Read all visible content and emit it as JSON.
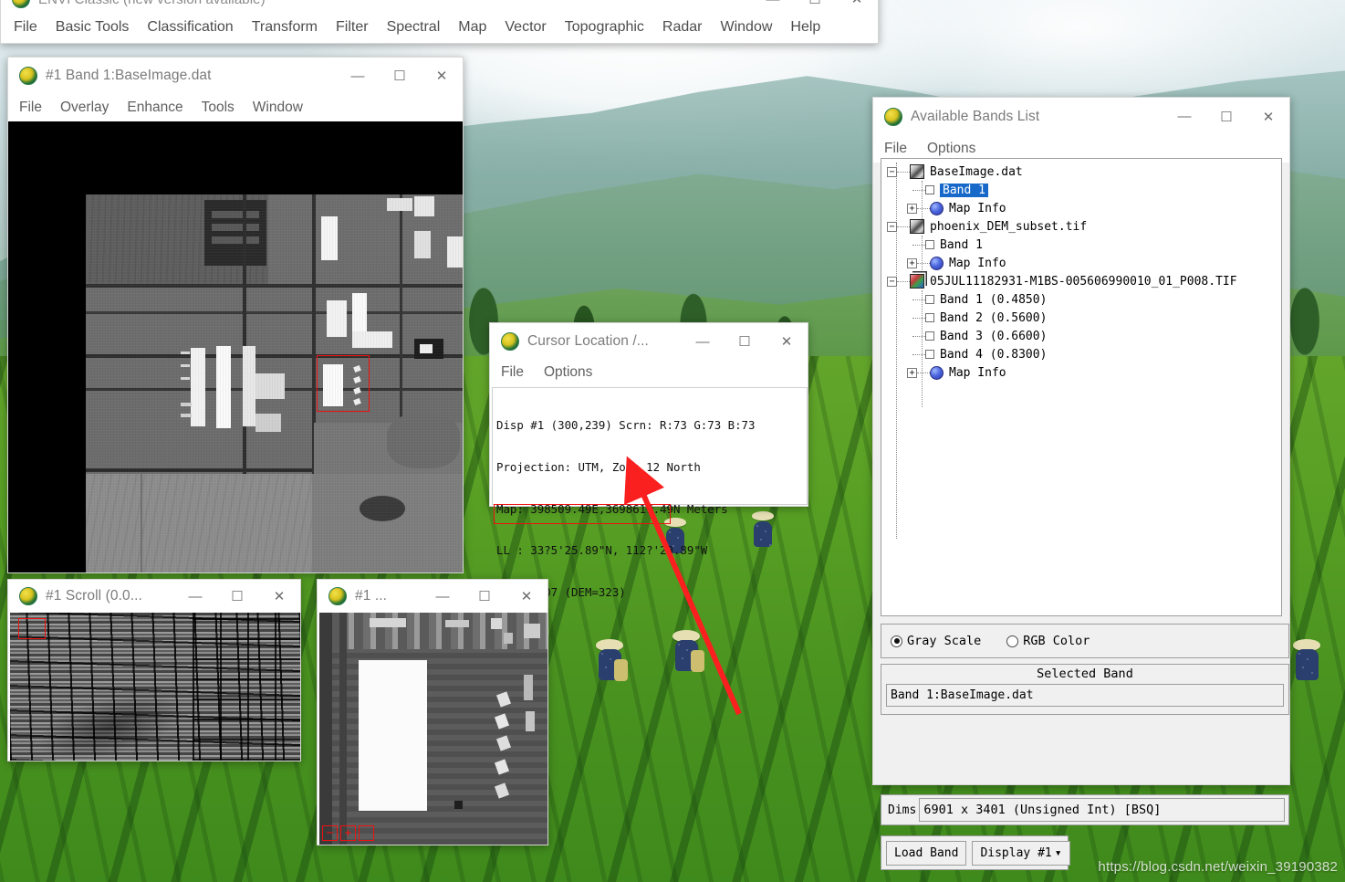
{
  "desktop": {
    "watermark": "https://blog.csdn.net/weixin_39190382"
  },
  "envi_main": {
    "title": "ENVI Classic (new version available)",
    "icon": "envi-globe-icon",
    "menu": [
      "File",
      "Basic Tools",
      "Classification",
      "Transform",
      "Filter",
      "Spectral",
      "Map",
      "Vector",
      "Topographic",
      "Radar",
      "Window",
      "Help"
    ],
    "window_buttons": {
      "minimize": "—",
      "maximize": "☐",
      "close": "✕"
    }
  },
  "display_window": {
    "title": "#1 Band 1:BaseImage.dat",
    "icon": "envi-globe-icon",
    "menu": [
      "File",
      "Overlay",
      "Enhance",
      "Tools",
      "Window"
    ],
    "window_buttons": {
      "minimize": "—",
      "maximize": "☐",
      "close": "✕"
    },
    "zoom_box_color": "#ee1111"
  },
  "cursor_location": {
    "title": "Cursor Location /...",
    "icon": "envi-globe-icon",
    "menu": [
      "File",
      "Options"
    ],
    "window_buttons": {
      "minimize": "—",
      "maximize": "☐",
      "close": "✕"
    },
    "lines": [
      "Disp #1 (300,239) Scrn: R:73 G:73 B:73",
      "Projection: UTM, Zone 12 North",
      "Map: 398509.49E,3698617.49N Meters",
      "LL : 33?5'25.89\"N, 112?'29.89\"W",
      "Data: 507 (DEM=323)"
    ],
    "highlight_color": "#ee1111",
    "highlighted_line": "Data: 507 (DEM=323)"
  },
  "available_bands": {
    "title": "Available Bands List",
    "icon": "envi-globe-icon",
    "menu": [
      "File",
      "Options"
    ],
    "window_buttons": {
      "minimize": "—",
      "maximize": "☐",
      "close": "✕"
    },
    "tree": [
      {
        "label": "BaseImage.dat",
        "type": "file",
        "icon": "image-file-icon",
        "expander": "−",
        "indent": 0
      },
      {
        "label": "Band 1",
        "type": "band",
        "icon": "checkbox-icon",
        "expander": "",
        "indent": 1,
        "selected": true
      },
      {
        "label": "Map Info",
        "type": "mapinfo",
        "icon": "globe-icon",
        "expander": "+",
        "indent": 1
      },
      {
        "label": "phoenix_DEM_subset.tif",
        "type": "file",
        "icon": "image-file-icon",
        "expander": "−",
        "indent": 0
      },
      {
        "label": "Band 1",
        "type": "band",
        "icon": "checkbox-icon",
        "expander": "",
        "indent": 1
      },
      {
        "label": "Map Info",
        "type": "mapinfo",
        "icon": "globe-icon",
        "expander": "+",
        "indent": 1
      },
      {
        "label": "05JUL11182931-M1BS-005606990010_01_P008.TIF",
        "type": "file",
        "icon": "multispectral-icon",
        "expander": "−",
        "indent": 0
      },
      {
        "label": "Band 1 (0.4850)",
        "type": "band",
        "icon": "checkbox-icon",
        "expander": "",
        "indent": 1
      },
      {
        "label": "Band 2 (0.5600)",
        "type": "band",
        "icon": "checkbox-icon",
        "expander": "",
        "indent": 1
      },
      {
        "label": "Band 3 (0.6600)",
        "type": "band",
        "icon": "checkbox-icon",
        "expander": "",
        "indent": 1
      },
      {
        "label": "Band 4 (0.8300)",
        "type": "band",
        "icon": "checkbox-icon",
        "expander": "",
        "indent": 1
      },
      {
        "label": "Map Info",
        "type": "mapinfo",
        "icon": "globe-icon",
        "expander": "+",
        "indent": 1
      }
    ],
    "color_mode": {
      "gray_scale": "Gray Scale",
      "rgb_color": "RGB Color",
      "selected": "Gray Scale"
    },
    "selected_band": {
      "title": "Selected Band",
      "value": "Band 1:BaseImage.dat"
    },
    "dims": {
      "label": "Dims",
      "value": "6901 x 3401 (Unsigned Int) [BSQ]"
    },
    "buttons": {
      "load_band": "Load Band",
      "display": "Display #1",
      "display_caret": "▾"
    },
    "selection_highlight_color": "#1669c9"
  },
  "scroll_window": {
    "title": "#1 Scroll (0.0...",
    "icon": "envi-globe-icon",
    "window_buttons": {
      "minimize": "—",
      "maximize": "☐",
      "close": "✕"
    },
    "viewbox_color": "#ee1111"
  },
  "zoom_window": {
    "title": "#1 ...",
    "icon": "envi-globe-icon",
    "window_buttons": {
      "minimize": "—",
      "maximize": "☐",
      "close": "✕"
    },
    "controls": [
      {
        "name": "zoom-out-button",
        "glyph": "−"
      },
      {
        "name": "zoom-in-button",
        "glyph": "+"
      },
      {
        "name": "zoom-select-button",
        "glyph": ""
      }
    ],
    "controls_color": "#ee1111"
  },
  "annotation": {
    "arrow_color": "#fa2020",
    "description": "red arrow pointing to Data line"
  }
}
